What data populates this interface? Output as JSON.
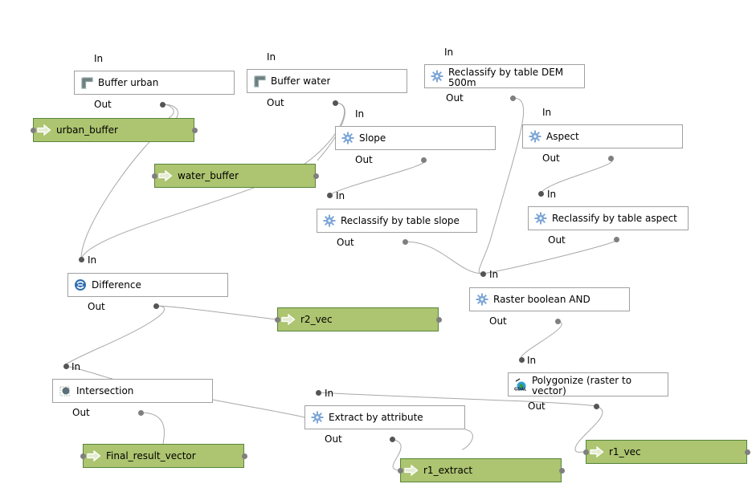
{
  "model": {
    "algorithms": [
      {
        "id": "buffer_urban",
        "label": "Buffer urban",
        "icon": "buffer-icon",
        "in": "In",
        "out": "Out"
      },
      {
        "id": "buffer_water",
        "label": "Buffer water",
        "icon": "buffer-icon",
        "in": "In",
        "out": "Out"
      },
      {
        "id": "reclass_dem",
        "label": "Reclassify by table DEM 500m",
        "icon": "gear-icon",
        "in": "In",
        "out": "Out"
      },
      {
        "id": "slope",
        "label": "Slope",
        "icon": "gear-icon",
        "in": "In",
        "out": "Out"
      },
      {
        "id": "aspect",
        "label": "Aspect",
        "icon": "gear-icon",
        "in": "In",
        "out": "Out"
      },
      {
        "id": "reclass_slope",
        "label": "Reclassify by table slope",
        "icon": "gear-icon",
        "in": "In",
        "out": "Out"
      },
      {
        "id": "reclass_aspect",
        "label": "Reclassify by table aspect",
        "icon": "gear-icon",
        "in": "In",
        "out": "Out"
      },
      {
        "id": "difference",
        "label": "Difference",
        "icon": "difference-icon",
        "in": "In",
        "out": "Out"
      },
      {
        "id": "raster_and",
        "label": "Raster boolean AND",
        "icon": "gear-icon",
        "in": "In",
        "out": "Out"
      },
      {
        "id": "polygonize",
        "label": "Polygonize (raster to vector)",
        "icon": "gdal-icon",
        "in": "In",
        "out": "Out"
      },
      {
        "id": "intersection",
        "label": "Intersection",
        "icon": "intersection-icon",
        "in": "In",
        "out": "Out"
      },
      {
        "id": "extract",
        "label": "Extract by attribute",
        "icon": "gear-icon",
        "in": "In",
        "out": "Out"
      }
    ],
    "outputs": [
      {
        "id": "urban_buffer",
        "label": "urban_buffer",
        "icon": "output-arrow-icon"
      },
      {
        "id": "water_buffer",
        "label": "water_buffer",
        "icon": "output-arrow-icon"
      },
      {
        "id": "r2_vec",
        "label": "r2_vec",
        "icon": "output-arrow-icon"
      },
      {
        "id": "final_result_vector",
        "label": "Final_result_vector",
        "icon": "output-arrow-icon"
      },
      {
        "id": "r1_extract",
        "label": "r1_extract",
        "icon": "output-arrow-icon"
      },
      {
        "id": "r1_vec",
        "label": "r1_vec",
        "icon": "output-arrow-icon"
      }
    ],
    "colors": {
      "output_fill": "#adc470",
      "output_border": "#57863d",
      "algorithm_border": "#a0a0a0",
      "link": "#a8a8a8"
    }
  }
}
